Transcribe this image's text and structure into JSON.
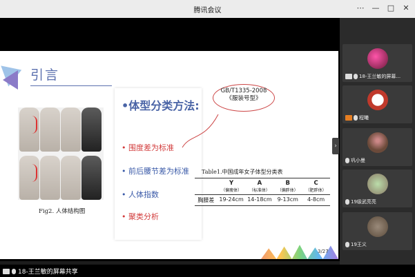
{
  "window": {
    "title": "腾讯会议",
    "controls": [
      "⋯",
      "—",
      "□",
      "✕"
    ]
  },
  "slide": {
    "heading": "引言",
    "figure_caption": "Fig2. 人体结构图",
    "methods_heading": "•体型分类方法:",
    "methods": [
      {
        "text": "• 围度差为标准",
        "color": "#d23c3c"
      },
      {
        "text": "• 前后腰节差为标准",
        "color": "#3a5aa8"
      },
      {
        "text": "• 人体指数",
        "color": "#3a5aa8"
      },
      {
        "text": "• 聚类分析",
        "color": "#d23c3c"
      }
    ],
    "callout": [
      "GB/T1335-2008",
      "《服装号型》"
    ],
    "table": {
      "caption": "Table1.中国成年女子体型分类表",
      "headers": [
        {
          "code": "Y",
          "note": "（偏瘦体）"
        },
        {
          "code": "A",
          "note": "（标准体）"
        },
        {
          "code": "B",
          "note": "（偏胖体）"
        },
        {
          "code": "C",
          "note": "（肥胖体）"
        }
      ],
      "row_label": "胸腰差",
      "values": [
        "19-24cm",
        "14-18cm",
        "9-13cm",
        "4-8cm"
      ]
    },
    "page_number": "3/27"
  },
  "share_label": "18-王兰敏的屏幕共享",
  "participants": [
    {
      "name": "18-王兰敏的屏幕...",
      "avatar_color": "#c44a6a"
    },
    {
      "name": "程曦",
      "avatar_color": "#c0392b"
    },
    {
      "name": "巩小曼",
      "avatar_color": "#6b4a3a"
    },
    {
      "name": "19级武亮亮",
      "avatar_color": "#8a7a66"
    },
    {
      "name": "19王义",
      "avatar_color": "#5a4a3a"
    }
  ],
  "colors": {
    "accent": "#4a64a6",
    "red": "#d23c3c"
  }
}
